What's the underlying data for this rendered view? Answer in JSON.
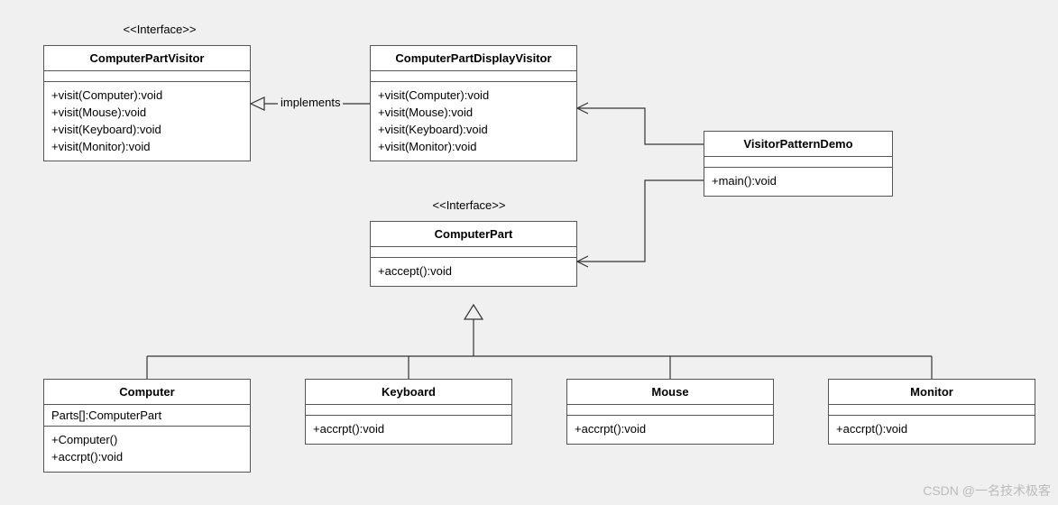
{
  "stereotypes": {
    "interface1": "<<Interface>>",
    "interface2": "<<Interface>>"
  },
  "boxes": {
    "visitor": {
      "title": "ComputerPartVisitor",
      "methods": "+visit(Computer):void\n+visit(Mouse):void\n+visit(Keyboard):void\n+visit(Monitor):void"
    },
    "displayVisitor": {
      "title": "ComputerPartDisplayVisitor",
      "methods": "+visit(Computer):void\n+visit(Mouse):void\n+visit(Keyboard):void\n+visit(Monitor):void"
    },
    "demo": {
      "title": "VisitorPatternDemo",
      "methods": "+main():void"
    },
    "part": {
      "title": "ComputerPart",
      "methods": "+accept():void"
    },
    "computer": {
      "title": "Computer",
      "attrs": "Parts[]:ComputerPart",
      "methods": "+Computer()\n+accrpt():void"
    },
    "keyboard": {
      "title": "Keyboard",
      "methods": "+accrpt():void"
    },
    "mouse": {
      "title": "Mouse",
      "methods": "+accrpt():void"
    },
    "monitor": {
      "title": "Monitor",
      "methods": "+accrpt():void"
    }
  },
  "edges": {
    "implementsLabel": "implements"
  },
  "watermark": "CSDN @一名技术极客"
}
